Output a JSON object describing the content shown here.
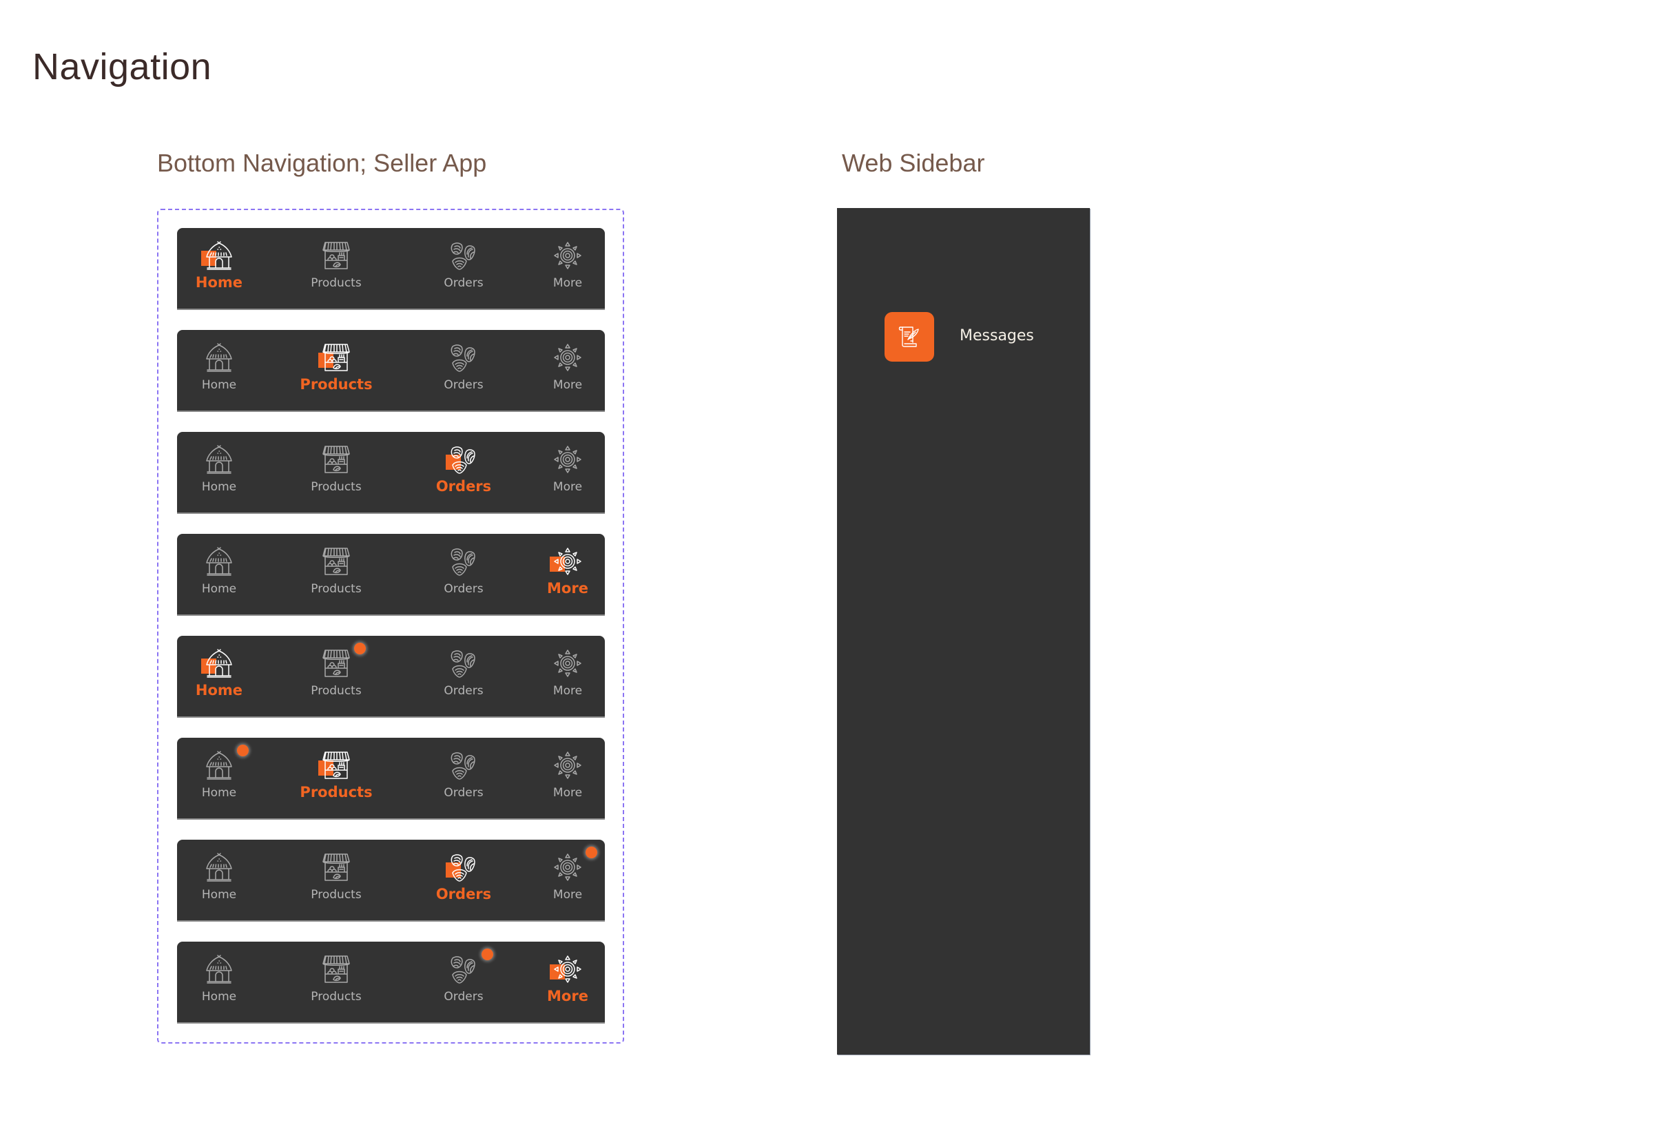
{
  "page": {
    "title": "Navigation"
  },
  "colors": {
    "accent": "#f26522",
    "bar_bg": "#333333",
    "inactive_text": "#b5b5b5",
    "frame_dash": "#8b74f3"
  },
  "bottom_nav": {
    "section_title": "Bottom Navigation; Seller App",
    "items": [
      {
        "key": "home",
        "label": "Home",
        "icon": "hut-icon"
      },
      {
        "key": "products",
        "label": "Products",
        "icon": "market-stall-icon"
      },
      {
        "key": "orders",
        "label": "Orders",
        "icon": "shells-icon"
      },
      {
        "key": "more",
        "label": "More",
        "icon": "sun-icon"
      }
    ],
    "variants": [
      {
        "active": "home",
        "badge": null
      },
      {
        "active": "products",
        "badge": null
      },
      {
        "active": "orders",
        "badge": null
      },
      {
        "active": "more",
        "badge": null
      },
      {
        "active": "home",
        "badge": "products"
      },
      {
        "active": "products",
        "badge": "home"
      },
      {
        "active": "orders",
        "badge": "more"
      },
      {
        "active": "more",
        "badge": "orders"
      }
    ]
  },
  "web_sidebar": {
    "section_title": "Web Sidebar",
    "items": [
      {
        "label": "Messages",
        "icon": "scroll-quill-icon",
        "active": true
      }
    ]
  }
}
